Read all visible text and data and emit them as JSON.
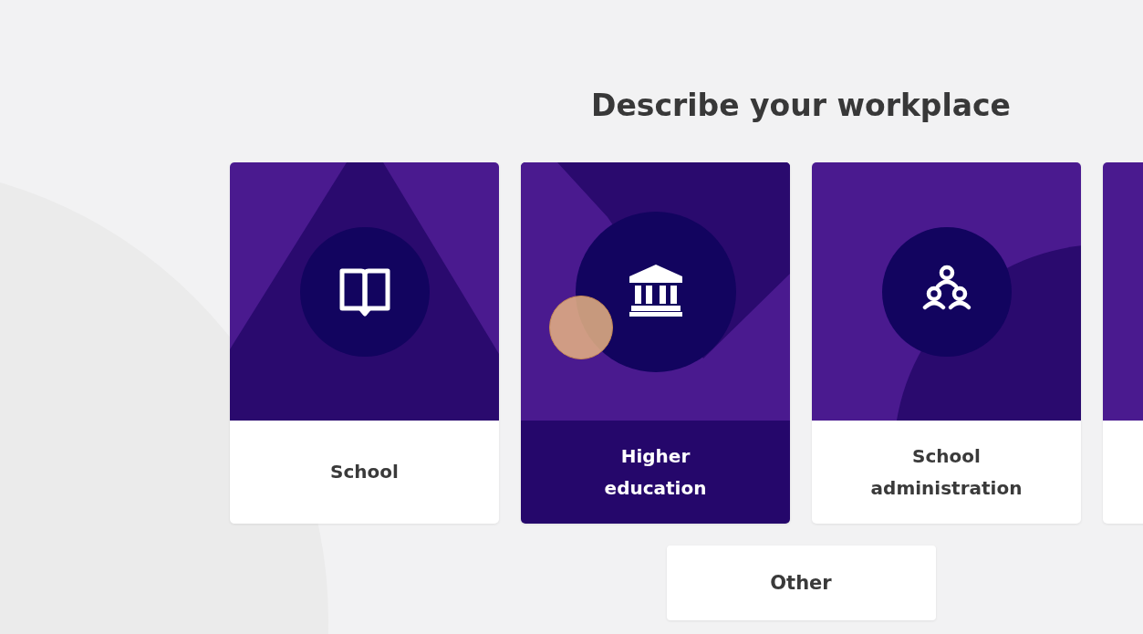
{
  "heading": "Describe your workplace",
  "cards": [
    {
      "label": "School",
      "kind": "triangle",
      "selected": false
    },
    {
      "label": "Higher education",
      "kind": "diagonal",
      "selected": true
    },
    {
      "label": "School administration",
      "kind": "arc",
      "selected": false
    },
    {
      "kind": "plain",
      "selected": false
    }
  ],
  "other_button": "Other"
}
